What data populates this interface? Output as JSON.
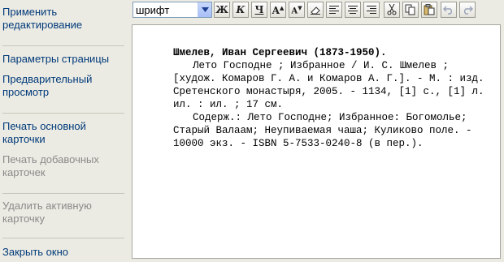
{
  "sidebar": {
    "apply_edit": "Применить редактирование",
    "page_params": "Параметры страницы",
    "preview": "Предварительный просмотр",
    "print_main": "Печать основной карточки",
    "print_extra": "Печать добавочных карточек",
    "delete_active": "Удалить активную карточку",
    "close_window": "Закрыть окно"
  },
  "toolbar": {
    "font_value": "шрифт",
    "bold": "Ж",
    "italic": "К",
    "underline": "Ч",
    "superscript": "A",
    "subscript": "A"
  },
  "card": {
    "heading": "Шмелев, Иван Сергеевич (1873-1950).",
    "body": "Лето Господне ; Избранное / И. С. Шмелев ; [худож. Комаров Г. А. и Комаров А. Г.]. - М. : изд. Сретенского монастыря, 2005. - 1134, [1] с., [1] л. ил. : ил. ; 17 см.",
    "contents": "Содерж.: Лето Господне; Избранное: Богомолье; Старый Валаам; Неупиваемая чаша; Куликово поле. - 10000 экз. - ISBN 5-7533-0240-8 (в пер.)."
  }
}
